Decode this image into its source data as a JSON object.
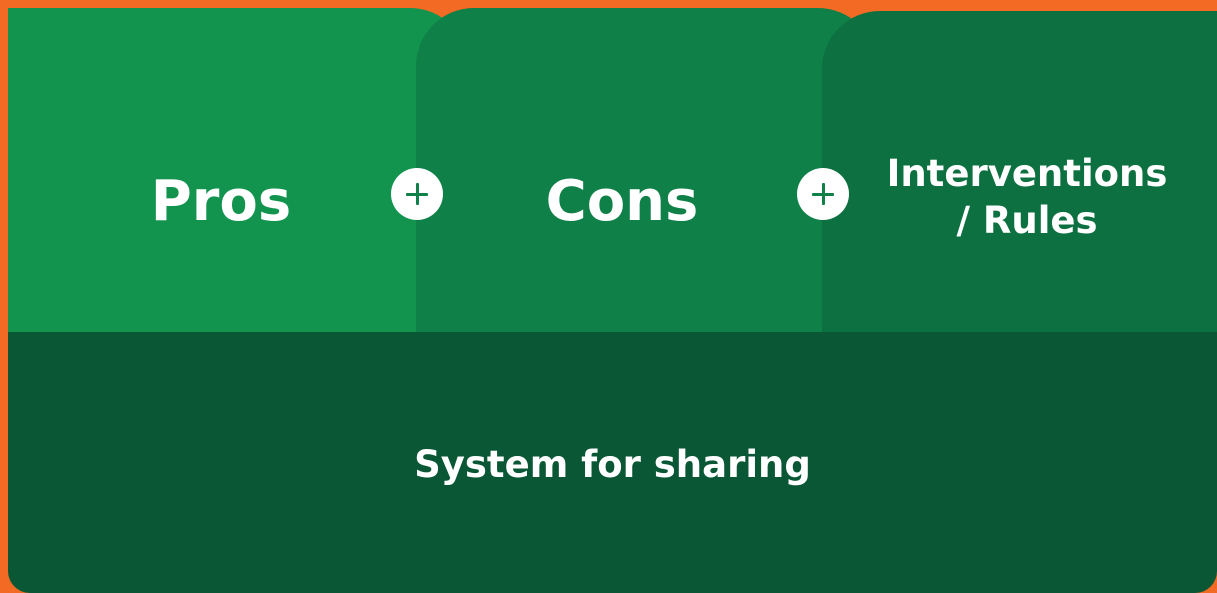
{
  "colors": {
    "background": "#f26a24",
    "pros_card": "#12944f",
    "cons_card": "#0f8048",
    "rules_card": "#0d7041",
    "base_card": "#0a5735",
    "text": "#ffffff",
    "connector_circle": "#ffffff",
    "connector_icon": "#0f8048"
  },
  "diagram": {
    "cards": [
      {
        "label": "Pros"
      },
      {
        "label": "Cons"
      },
      {
        "label_lines": [
          "Interventions",
          "/ Rules"
        ]
      }
    ],
    "connectors": [
      {
        "icon": "plus-icon"
      },
      {
        "icon": "plus-icon"
      }
    ],
    "base": {
      "label": "System for sharing"
    }
  }
}
